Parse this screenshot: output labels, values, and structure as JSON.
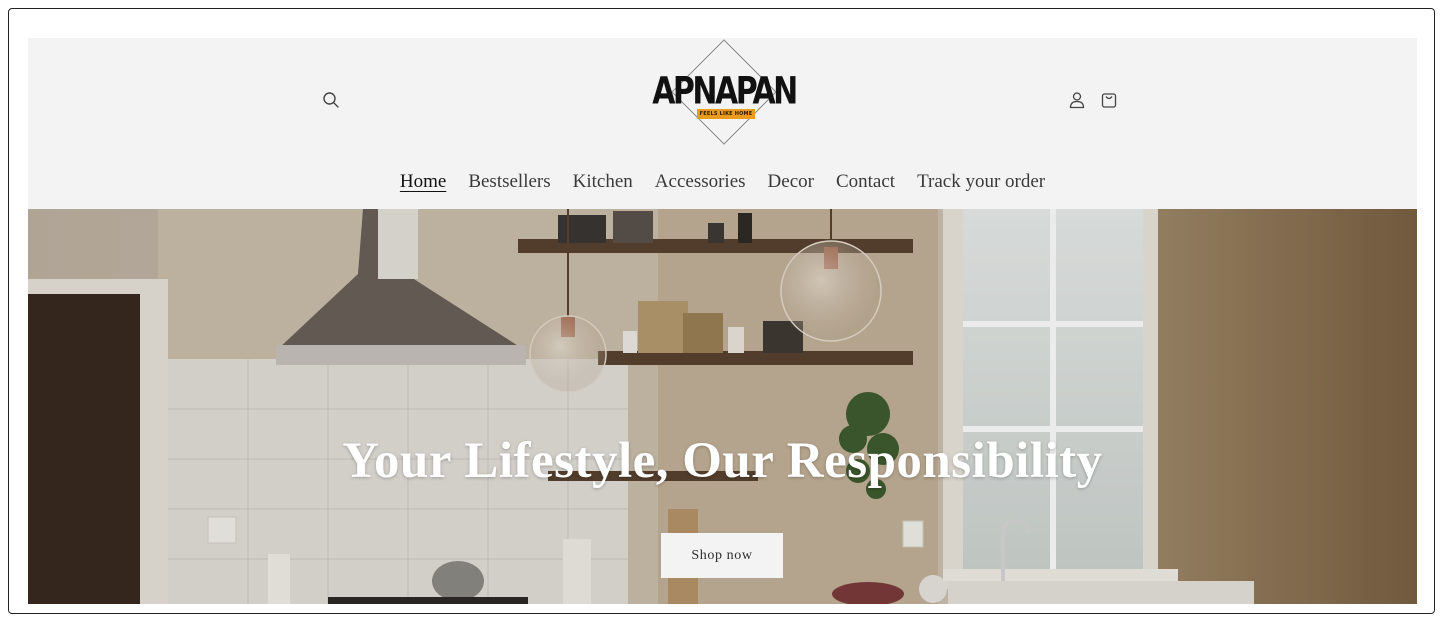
{
  "logo": {
    "name": "APNAPAN",
    "tagline": "FEELS LIKE HOME"
  },
  "header": {
    "icons": [
      "search-icon",
      "account-icon",
      "cart-icon"
    ]
  },
  "nav": {
    "items": [
      "Home",
      "Bestsellers",
      "Kitchen",
      "Accessories",
      "Decor",
      "Contact",
      "Track your order"
    ],
    "active": "Home"
  },
  "hero": {
    "title": "Your Lifestyle, Our Responsibility",
    "button_label": "Shop now"
  },
  "colors": {
    "header_bg": "#f3f3f3",
    "logo_accent": "#e89b1c",
    "text": "#121212"
  }
}
